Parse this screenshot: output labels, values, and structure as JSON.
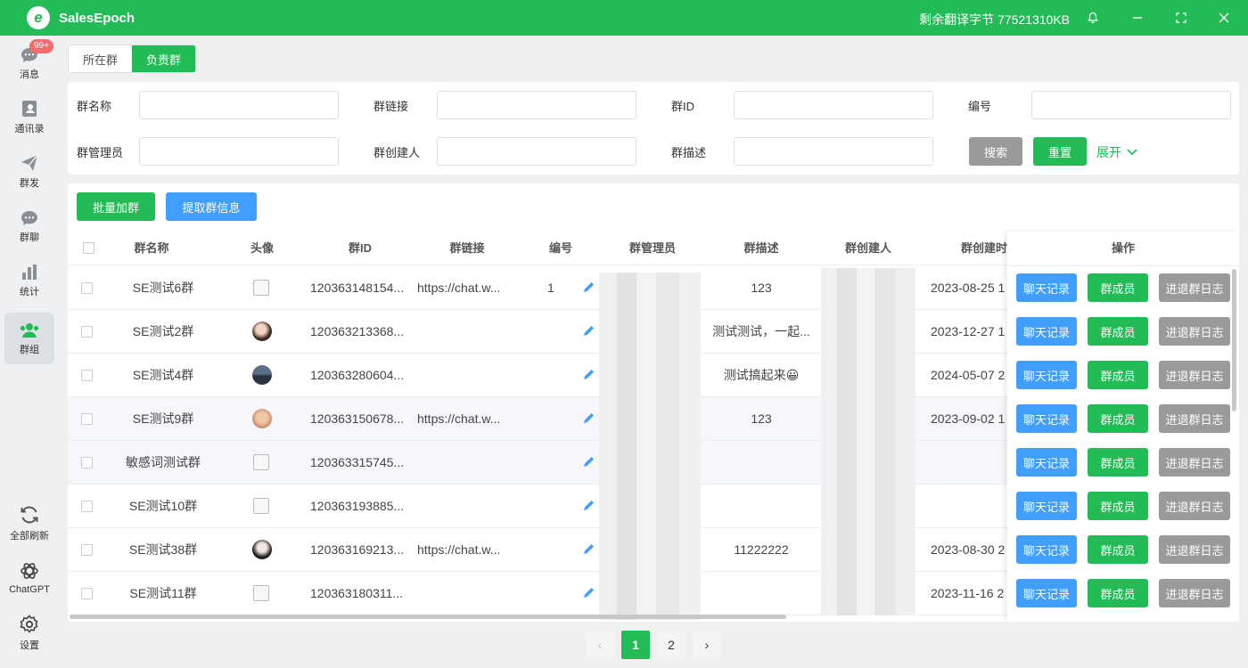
{
  "app": {
    "title": "SalesEpoch",
    "remaining": "剩余翻译字节 77521310KB"
  },
  "sidebar": {
    "items": [
      {
        "label": "消息",
        "icon": "chat-bubble-icon",
        "badge": "99+"
      },
      {
        "label": "通讯录",
        "icon": "contacts-icon"
      },
      {
        "label": "群发",
        "icon": "paper-plane-icon"
      },
      {
        "label": "群聊",
        "icon": "group-chat-icon"
      },
      {
        "label": "统计",
        "icon": "bar-chart-icon"
      },
      {
        "label": "群组",
        "icon": "users-icon",
        "active": true
      }
    ],
    "bottom": [
      {
        "label": "全部刷新",
        "icon": "refresh-icon"
      },
      {
        "label": "ChatGPT",
        "icon": "openai-icon"
      },
      {
        "label": "设置",
        "icon": "settings-icon"
      }
    ]
  },
  "tabs": [
    {
      "label": "所在群"
    },
    {
      "label": "负责群",
      "active": true
    }
  ],
  "filter": {
    "group_name": "群名称",
    "group_link": "群链接",
    "group_id": "群ID",
    "number": "编号",
    "admin": "群管理员",
    "creator": "群创建人",
    "description": "群描述",
    "search": "搜索",
    "reset": "重置",
    "expand": "展开"
  },
  "actions": {
    "batch_join": "批量加群",
    "fetch_info": "提取群信息"
  },
  "table": {
    "columns": {
      "name": "群名称",
      "avatar": "头像",
      "id": "群ID",
      "link": "群链接",
      "number": "编号",
      "admin": "群管理员",
      "desc": "群描述",
      "creator": "群创建人",
      "created": "群创建时",
      "ops": "操作"
    },
    "rows": [
      {
        "name": "SE测试6群",
        "id": "120363148154...",
        "link": "https://chat.w...",
        "number": "1",
        "desc": "123",
        "created": "2023-08-25 1"
      },
      {
        "name": "SE测试2群",
        "id": "120363213368...",
        "link": "",
        "number": "",
        "desc": "测试测试，一起...",
        "created": "2023-12-27 1"
      },
      {
        "name": "SE测试4群",
        "id": "120363280604...",
        "link": "",
        "number": "",
        "desc": "测试搞起来😀",
        "created": "2024-05-07 2"
      },
      {
        "name": "SE测试9群",
        "id": "120363150678...",
        "link": "https://chat.w...",
        "number": "",
        "desc": "123",
        "created": "2023-09-02 1"
      },
      {
        "name": "敏感词测试群",
        "id": "120363315745...",
        "link": "",
        "number": "",
        "desc": "",
        "created": ""
      },
      {
        "name": "SE测试10群",
        "id": "120363193885...",
        "link": "",
        "number": "",
        "desc": "",
        "created": ""
      },
      {
        "name": "SE测试38群",
        "id": "120363169213...",
        "link": "https://chat.w...",
        "number": "",
        "desc": "11222222",
        "created": "2023-08-30 2"
      },
      {
        "name": "SE测试11群",
        "id": "120363180311...",
        "link": "",
        "number": "",
        "desc": "",
        "created": "2023-11-16 2"
      }
    ],
    "op_labels": {
      "chat": "聊天记录",
      "members": "群成员",
      "log": "进退群日志"
    }
  },
  "pagination": {
    "prev": "‹",
    "pages": [
      "1",
      "2"
    ],
    "current": "1",
    "next": "›"
  },
  "colors": {
    "brand": "#22bb55",
    "blue": "#409eff",
    "grey": "#9a9a9a"
  }
}
